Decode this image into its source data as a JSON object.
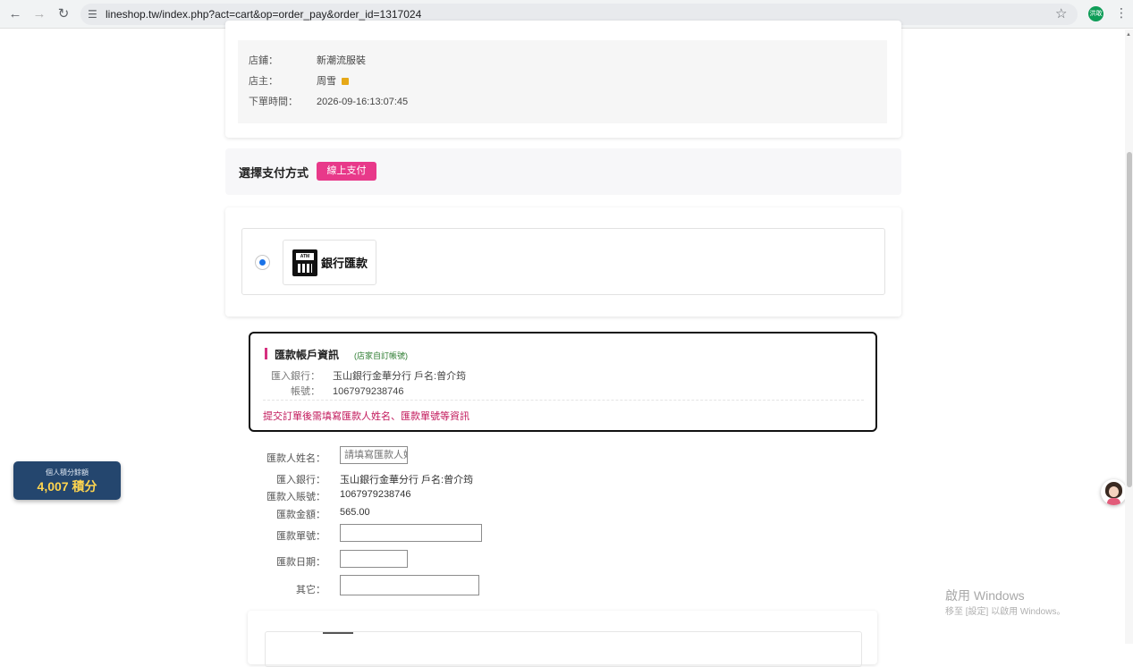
{
  "browser": {
    "url": "lineshop.tw/index.php?act=cart&op=order_pay&order_id=1317024",
    "profile_initials": "洪敢"
  },
  "order_info": {
    "shop_label": "店鋪：",
    "shop_value": "新潮流服裝",
    "owner_label": "店主：",
    "owner_value": "周雪",
    "time_label": "下單時間：",
    "time_value": "2026-09-16:13:07:45"
  },
  "payment": {
    "title": "選擇支付方式",
    "online_button": "線上支付",
    "method_label": "銀行匯款",
    "atm_text": "ATM"
  },
  "bank_account": {
    "title": "匯款帳戶資訊",
    "tag": "(店家自訂帳號)",
    "bank_label": "匯入銀行：",
    "bank_value": "玉山銀行金華分行 戶名:曾介筠",
    "account_label": "帳號：",
    "account_value": "1067979238746",
    "note": "提交訂單後需填寫匯款人姓名、匯款單號等資訊"
  },
  "form": {
    "payer_name_label": "匯款人姓名：",
    "payer_name_placeholder": "請填寫匯款人姓名",
    "bank_label": "匯入銀行：",
    "bank_value": "玉山銀行金華分行 戶名:曾介筠",
    "account_label": "匯款入賬號：",
    "account_value": "1067979238746",
    "amount_label": "匯款金額：",
    "amount_value": "565.00",
    "serial_label": "匯款單號：",
    "date_label": "匯款日期：",
    "other_label": "其它："
  },
  "points_badge": {
    "label": "個人積分餘額",
    "value": "4,007 積分"
  },
  "watermark": {
    "line1": "啟用 Windows",
    "line2": "移至 [設定] 以啟用 Windows。"
  }
}
